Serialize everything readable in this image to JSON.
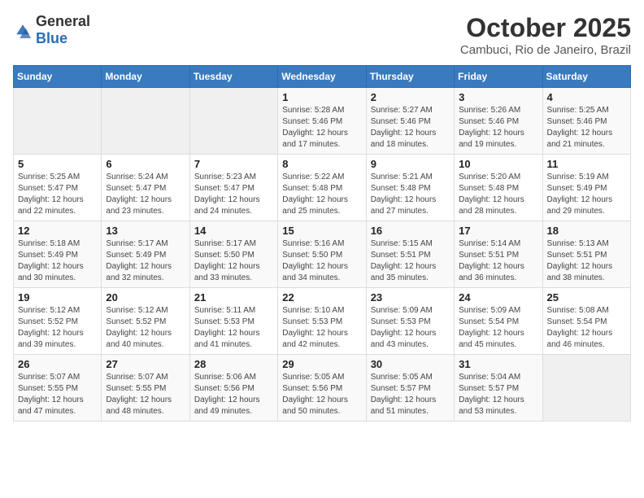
{
  "logo": {
    "general": "General",
    "blue": "Blue"
  },
  "header": {
    "month": "October 2025",
    "location": "Cambuci, Rio de Janeiro, Brazil"
  },
  "weekdays": [
    "Sunday",
    "Monday",
    "Tuesday",
    "Wednesday",
    "Thursday",
    "Friday",
    "Saturday"
  ],
  "weeks": [
    [
      {
        "day": "",
        "sunrise": "",
        "sunset": "",
        "daylight": ""
      },
      {
        "day": "",
        "sunrise": "",
        "sunset": "",
        "daylight": ""
      },
      {
        "day": "",
        "sunrise": "",
        "sunset": "",
        "daylight": ""
      },
      {
        "day": "1",
        "sunrise": "Sunrise: 5:28 AM",
        "sunset": "Sunset: 5:46 PM",
        "daylight": "Daylight: 12 hours and 17 minutes."
      },
      {
        "day": "2",
        "sunrise": "Sunrise: 5:27 AM",
        "sunset": "Sunset: 5:46 PM",
        "daylight": "Daylight: 12 hours and 18 minutes."
      },
      {
        "day": "3",
        "sunrise": "Sunrise: 5:26 AM",
        "sunset": "Sunset: 5:46 PM",
        "daylight": "Daylight: 12 hours and 19 minutes."
      },
      {
        "day": "4",
        "sunrise": "Sunrise: 5:25 AM",
        "sunset": "Sunset: 5:46 PM",
        "daylight": "Daylight: 12 hours and 21 minutes."
      }
    ],
    [
      {
        "day": "5",
        "sunrise": "Sunrise: 5:25 AM",
        "sunset": "Sunset: 5:47 PM",
        "daylight": "Daylight: 12 hours and 22 minutes."
      },
      {
        "day": "6",
        "sunrise": "Sunrise: 5:24 AM",
        "sunset": "Sunset: 5:47 PM",
        "daylight": "Daylight: 12 hours and 23 minutes."
      },
      {
        "day": "7",
        "sunrise": "Sunrise: 5:23 AM",
        "sunset": "Sunset: 5:47 PM",
        "daylight": "Daylight: 12 hours and 24 minutes."
      },
      {
        "day": "8",
        "sunrise": "Sunrise: 5:22 AM",
        "sunset": "Sunset: 5:48 PM",
        "daylight": "Daylight: 12 hours and 25 minutes."
      },
      {
        "day": "9",
        "sunrise": "Sunrise: 5:21 AM",
        "sunset": "Sunset: 5:48 PM",
        "daylight": "Daylight: 12 hours and 27 minutes."
      },
      {
        "day": "10",
        "sunrise": "Sunrise: 5:20 AM",
        "sunset": "Sunset: 5:48 PM",
        "daylight": "Daylight: 12 hours and 28 minutes."
      },
      {
        "day": "11",
        "sunrise": "Sunrise: 5:19 AM",
        "sunset": "Sunset: 5:49 PM",
        "daylight": "Daylight: 12 hours and 29 minutes."
      }
    ],
    [
      {
        "day": "12",
        "sunrise": "Sunrise: 5:18 AM",
        "sunset": "Sunset: 5:49 PM",
        "daylight": "Daylight: 12 hours and 30 minutes."
      },
      {
        "day": "13",
        "sunrise": "Sunrise: 5:17 AM",
        "sunset": "Sunset: 5:49 PM",
        "daylight": "Daylight: 12 hours and 32 minutes."
      },
      {
        "day": "14",
        "sunrise": "Sunrise: 5:17 AM",
        "sunset": "Sunset: 5:50 PM",
        "daylight": "Daylight: 12 hours and 33 minutes."
      },
      {
        "day": "15",
        "sunrise": "Sunrise: 5:16 AM",
        "sunset": "Sunset: 5:50 PM",
        "daylight": "Daylight: 12 hours and 34 minutes."
      },
      {
        "day": "16",
        "sunrise": "Sunrise: 5:15 AM",
        "sunset": "Sunset: 5:51 PM",
        "daylight": "Daylight: 12 hours and 35 minutes."
      },
      {
        "day": "17",
        "sunrise": "Sunrise: 5:14 AM",
        "sunset": "Sunset: 5:51 PM",
        "daylight": "Daylight: 12 hours and 36 minutes."
      },
      {
        "day": "18",
        "sunrise": "Sunrise: 5:13 AM",
        "sunset": "Sunset: 5:51 PM",
        "daylight": "Daylight: 12 hours and 38 minutes."
      }
    ],
    [
      {
        "day": "19",
        "sunrise": "Sunrise: 5:12 AM",
        "sunset": "Sunset: 5:52 PM",
        "daylight": "Daylight: 12 hours and 39 minutes."
      },
      {
        "day": "20",
        "sunrise": "Sunrise: 5:12 AM",
        "sunset": "Sunset: 5:52 PM",
        "daylight": "Daylight: 12 hours and 40 minutes."
      },
      {
        "day": "21",
        "sunrise": "Sunrise: 5:11 AM",
        "sunset": "Sunset: 5:53 PM",
        "daylight": "Daylight: 12 hours and 41 minutes."
      },
      {
        "day": "22",
        "sunrise": "Sunrise: 5:10 AM",
        "sunset": "Sunset: 5:53 PM",
        "daylight": "Daylight: 12 hours and 42 minutes."
      },
      {
        "day": "23",
        "sunrise": "Sunrise: 5:09 AM",
        "sunset": "Sunset: 5:53 PM",
        "daylight": "Daylight: 12 hours and 43 minutes."
      },
      {
        "day": "24",
        "sunrise": "Sunrise: 5:09 AM",
        "sunset": "Sunset: 5:54 PM",
        "daylight": "Daylight: 12 hours and 45 minutes."
      },
      {
        "day": "25",
        "sunrise": "Sunrise: 5:08 AM",
        "sunset": "Sunset: 5:54 PM",
        "daylight": "Daylight: 12 hours and 46 minutes."
      }
    ],
    [
      {
        "day": "26",
        "sunrise": "Sunrise: 5:07 AM",
        "sunset": "Sunset: 5:55 PM",
        "daylight": "Daylight: 12 hours and 47 minutes."
      },
      {
        "day": "27",
        "sunrise": "Sunrise: 5:07 AM",
        "sunset": "Sunset: 5:55 PM",
        "daylight": "Daylight: 12 hours and 48 minutes."
      },
      {
        "day": "28",
        "sunrise": "Sunrise: 5:06 AM",
        "sunset": "Sunset: 5:56 PM",
        "daylight": "Daylight: 12 hours and 49 minutes."
      },
      {
        "day": "29",
        "sunrise": "Sunrise: 5:05 AM",
        "sunset": "Sunset: 5:56 PM",
        "daylight": "Daylight: 12 hours and 50 minutes."
      },
      {
        "day": "30",
        "sunrise": "Sunrise: 5:05 AM",
        "sunset": "Sunset: 5:57 PM",
        "daylight": "Daylight: 12 hours and 51 minutes."
      },
      {
        "day": "31",
        "sunrise": "Sunrise: 5:04 AM",
        "sunset": "Sunset: 5:57 PM",
        "daylight": "Daylight: 12 hours and 53 minutes."
      },
      {
        "day": "",
        "sunrise": "",
        "sunset": "",
        "daylight": ""
      }
    ]
  ]
}
